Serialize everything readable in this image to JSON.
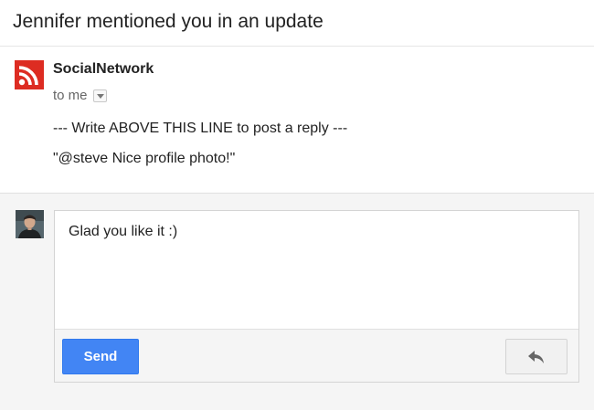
{
  "subject": "Jennifer mentioned you in an update",
  "sender": {
    "name": "SocialNetwork",
    "to_label": "to me",
    "logo_icon": "rss-icon",
    "logo_color": "#dd2c22"
  },
  "message": {
    "line1": "--- Write ABOVE THIS LINE to post a reply ---",
    "line2": "\"@steve Nice profile photo!\""
  },
  "reply": {
    "avatar_icon": "user-avatar",
    "text": "Glad you like it :)",
    "send_label": "Send",
    "reply_icon": "reply-arrow-icon",
    "send_color": "#4285f4"
  }
}
